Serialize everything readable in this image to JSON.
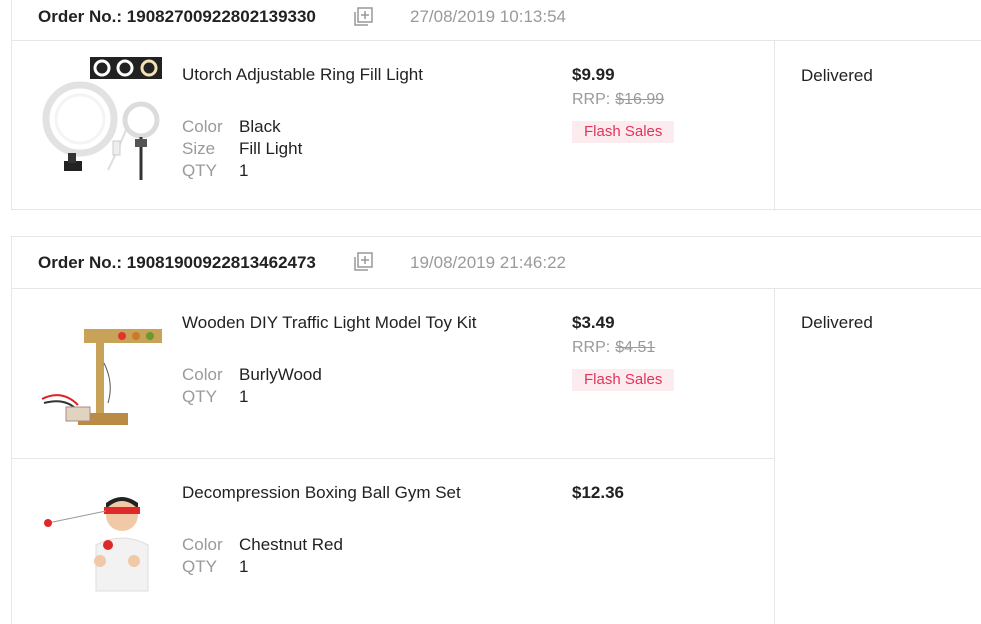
{
  "orders": [
    {
      "label": "Order No.:",
      "number": "19082700922802139330",
      "date": "27/08/2019 10:13:54",
      "status": "Delivered",
      "items": [
        {
          "title": "Utorch Adjustable Ring Fill Light",
          "price": "$9.99",
          "rrp_label": "RRP:",
          "rrp": "$16.99",
          "badge": "Flash Sales",
          "attrs": [
            {
              "k": "Color",
              "v": "Black"
            },
            {
              "k": "Size",
              "v": "Fill Light"
            },
            {
              "k": "QTY",
              "v": "1"
            }
          ]
        }
      ]
    },
    {
      "label": "Order No.:",
      "number": "19081900922813462473",
      "date": "19/08/2019 21:46:22",
      "status": "Delivered",
      "items": [
        {
          "title": "Wooden DIY Traffic Light Model Toy Kit",
          "price": "$3.49",
          "rrp_label": "RRP:",
          "rrp": "$4.51",
          "badge": "Flash Sales",
          "attrs": [
            {
              "k": "Color",
              "v": "BurlyWood"
            },
            {
              "k": "QTY",
              "v": "1"
            }
          ]
        },
        {
          "title": "Decompression Boxing Ball Gym Set",
          "price": "$12.36",
          "attrs": [
            {
              "k": "Color",
              "v": "Chestnut Red"
            },
            {
              "k": "QTY",
              "v": "1"
            }
          ]
        }
      ]
    }
  ]
}
